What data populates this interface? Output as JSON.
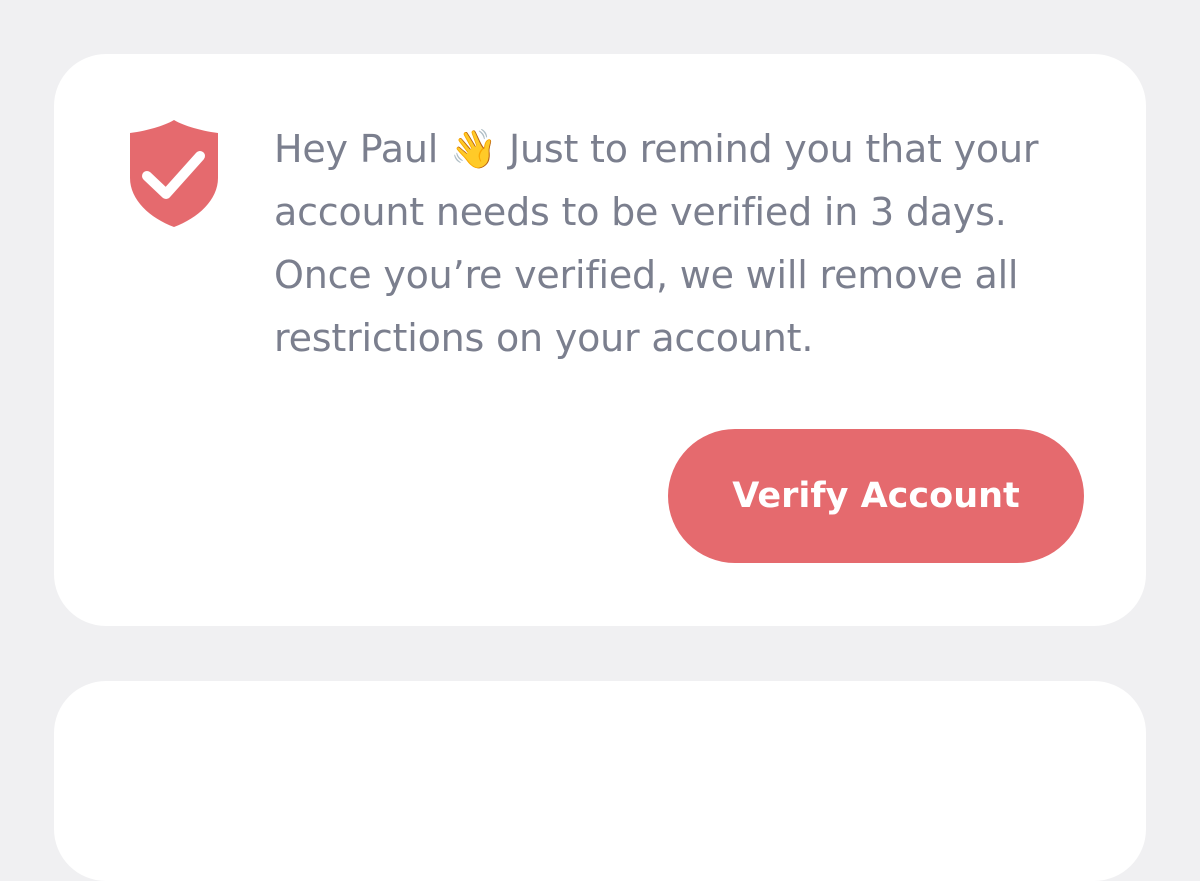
{
  "notice": {
    "greeting": "Hey Paul",
    "wave_emoji": "👋",
    "message": "Just to remind you that your account needs to be verified in 3 days. Once you’re verified, we will remove all restrictions on your account.",
    "button_label": "Verify Account",
    "icon": "shield-check-icon",
    "accent_color": "#e56a6e"
  }
}
